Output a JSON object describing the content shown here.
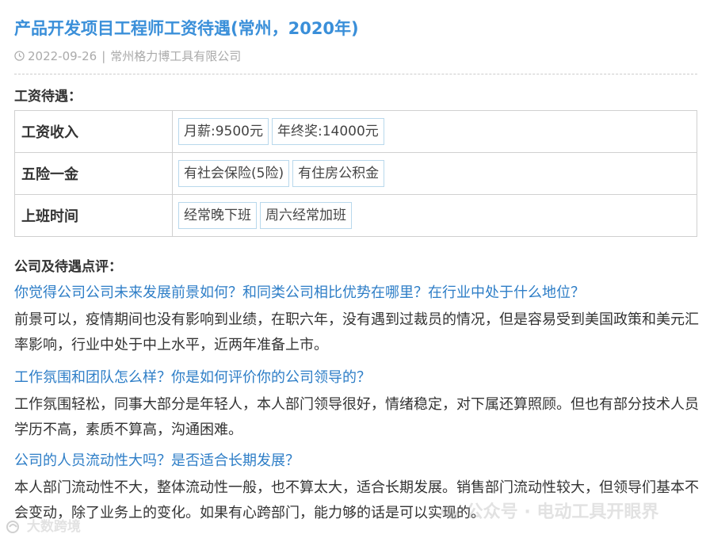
{
  "header": {
    "title": "产品开发项目工程师工资待遇(常州，2020年)",
    "date": "2022-09-26",
    "separator": "|",
    "company": "常州格力博工具有限公司"
  },
  "salary_section": {
    "heading": "工资待遇：",
    "rows": [
      {
        "label": "工资收入",
        "tags": [
          "月薪:9500元",
          "年终奖:14000元"
        ]
      },
      {
        "label": "五险一金",
        "tags": [
          "有社会保险(5险)",
          "有住房公积金"
        ]
      },
      {
        "label": "上班时间",
        "tags": [
          "经常晚下班",
          "周六经常加班"
        ]
      }
    ]
  },
  "review_section": {
    "heading": "公司及待遇点评：",
    "items": [
      {
        "question": "你觉得公司公司未来发展前景如何？和同类公司相比优势在哪里？在行业中处于什么地位？",
        "answer": "前景可以，疫情期间也没有影响到业绩，在职六年，没有遇到过裁员的情况，但是容易受到美国政策和美元汇率影响，行业中处于中上水平，近两年准备上市。"
      },
      {
        "question": "工作氛围和团队怎么样？你是如何评价你的公司领导的？",
        "answer": "工作氛围轻松，同事大部分是年轻人，本人部门领导很好，情绪稳定，对下属还算照顾。但也有部分技术人员学历不高，素质不算高，沟通困难。"
      },
      {
        "question": "公司的人员流动性大吗？是否适合长期发展？",
        "answer": "本人部门流动性不大，整体流动性一般，也不算太大，适合长期发展。销售部门流动性较大，但领导们基本不会变动，除了业务上的变化。如果有心跨部门，能力够的话是可以实现的。"
      }
    ]
  },
  "watermarks": {
    "left": "大数跨境",
    "right": "公众号 · 电动工具开眼界"
  },
  "colors": {
    "title": "#3a8fd9",
    "question": "#2e7ec7",
    "tag_border": "#b8d8ec"
  }
}
